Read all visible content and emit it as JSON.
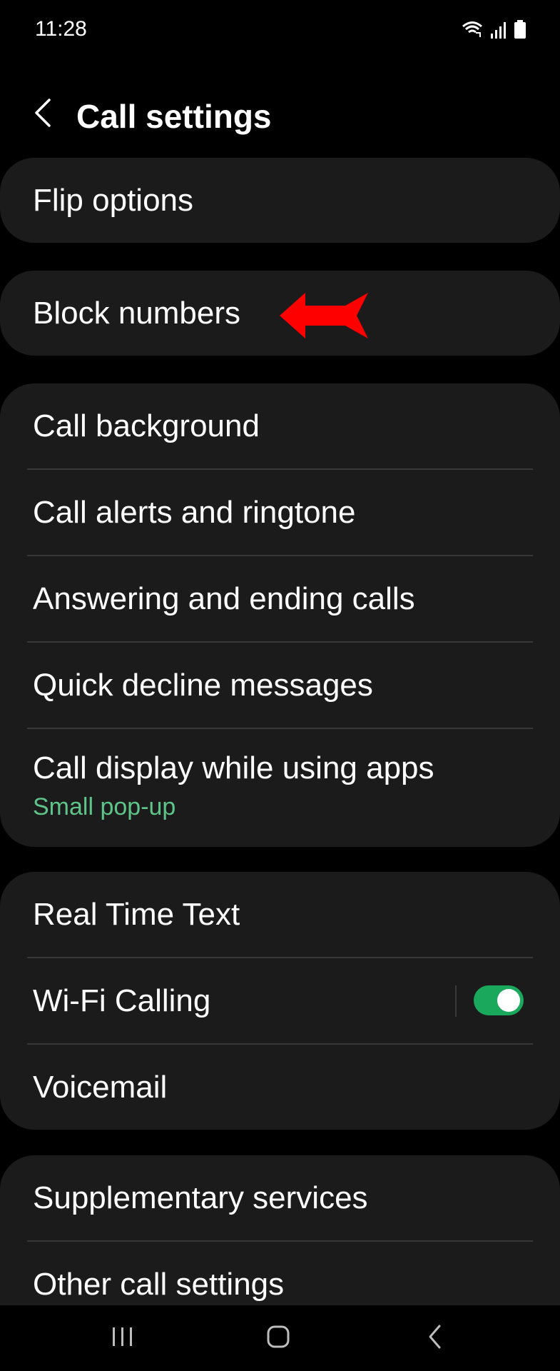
{
  "status_bar": {
    "time": "11:28",
    "icons": [
      "wifi-calling-icon",
      "signal-icon",
      "battery-icon"
    ]
  },
  "header": {
    "back_icon": "chevron-left-icon",
    "title": "Call settings"
  },
  "groups": [
    {
      "items": [
        {
          "label": "Flip options"
        }
      ]
    },
    {
      "items": [
        {
          "label": "Block numbers"
        }
      ]
    },
    {
      "items": [
        {
          "label": "Call background"
        },
        {
          "label": "Call alerts and ringtone"
        },
        {
          "label": "Answering and ending calls"
        },
        {
          "label": "Quick decline messages"
        },
        {
          "label": "Call display while using apps",
          "sub": "Small pop-up"
        }
      ]
    },
    {
      "items": [
        {
          "label": "Real Time Text"
        },
        {
          "label": "Wi-Fi Calling",
          "toggle": true
        },
        {
          "label": "Voicemail"
        }
      ]
    },
    {
      "items": [
        {
          "label": "Supplementary services"
        },
        {
          "label": "Other call settings"
        }
      ]
    }
  ],
  "annotation": {
    "icon": "red-arrow-icon",
    "color": "#ff0000"
  },
  "nav_bar": {
    "icons": [
      "recent-apps-icon",
      "home-icon",
      "back-icon"
    ]
  },
  "colors": {
    "background": "#000000",
    "card": "#1b1b1b",
    "accent_green": "#5ec48a",
    "toggle_on": "#1aa85d"
  }
}
